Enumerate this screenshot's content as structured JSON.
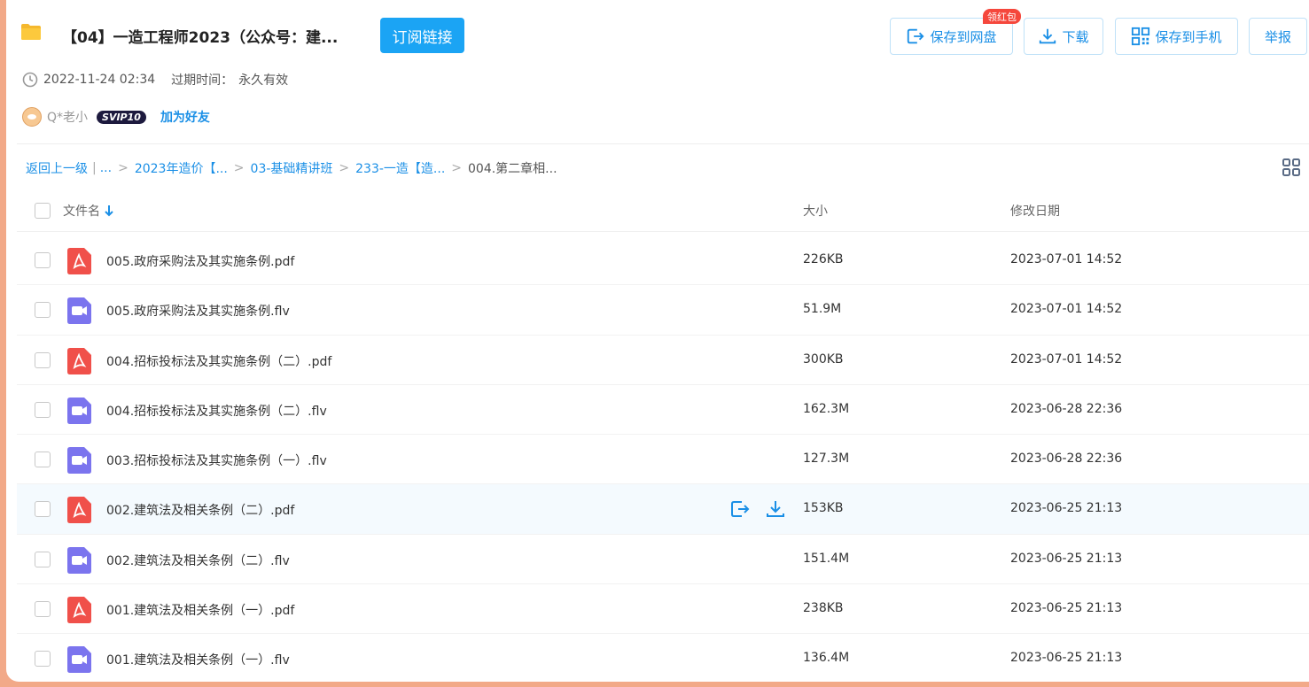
{
  "header": {
    "title": "【04】一造工程师2023（公众号：建...",
    "subscribe_label": "订阅链接",
    "actions": {
      "save_label": "保存到网盘",
      "download_label": "下载",
      "phone_label": "保存到手机",
      "report_label": "举报",
      "redpack_badge": "领红包"
    },
    "created": "2022-11-24 02:34",
    "expire_label": "过期时间：",
    "expire_value": "永久有效",
    "user": {
      "name": "Q*老小",
      "vip": "SVIP10",
      "add_friend": "加为好友"
    }
  },
  "breadcrumb": {
    "back": "返回上一级",
    "sep": "|",
    "ellipsis": "...",
    "items": [
      "2023年造价【...",
      "03-基础精讲班",
      "233-一造【造..."
    ],
    "current": "004.第二章相..."
  },
  "table": {
    "headers": {
      "name": "文件名",
      "size": "大小",
      "date": "修改日期"
    },
    "rows": [
      {
        "name": "005.政府采购法及其实施条例.pdf",
        "type": "pdf",
        "size": "226KB",
        "date": "2023-07-01 14:52"
      },
      {
        "name": "005.政府采购法及其实施条例.flv",
        "type": "video",
        "size": "51.9M",
        "date": "2023-07-01 14:52"
      },
      {
        "name": "004.招标投标法及其实施条例（二）.pdf",
        "type": "pdf",
        "size": "300KB",
        "date": "2023-07-01 14:52"
      },
      {
        "name": "004.招标投标法及其实施条例（二）.flv",
        "type": "video",
        "size": "162.3M",
        "date": "2023-06-28 22:36"
      },
      {
        "name": "003.招标投标法及其实施条例（一）.flv",
        "type": "video",
        "size": "127.3M",
        "date": "2023-06-28 22:36"
      },
      {
        "name": "002.建筑法及相关条例（二）.pdf",
        "type": "pdf",
        "size": "153KB",
        "date": "2023-06-25 21:13",
        "hovered": true
      },
      {
        "name": "002.建筑法及相关条例（二）.flv",
        "type": "video",
        "size": "151.4M",
        "date": "2023-06-25 21:13"
      },
      {
        "name": "001.建筑法及相关条例（一）.pdf",
        "type": "pdf",
        "size": "238KB",
        "date": "2023-06-25 21:13"
      },
      {
        "name": "001.建筑法及相关条例（一）.flv",
        "type": "video",
        "size": "136.4M",
        "date": "2023-06-25 21:13"
      }
    ]
  },
  "colors": {
    "accent": "#1a8fe6",
    "button": "#1ba4f4",
    "pdf": "#f0504a",
    "video": "#7b74ee",
    "border": "#f2a988"
  }
}
